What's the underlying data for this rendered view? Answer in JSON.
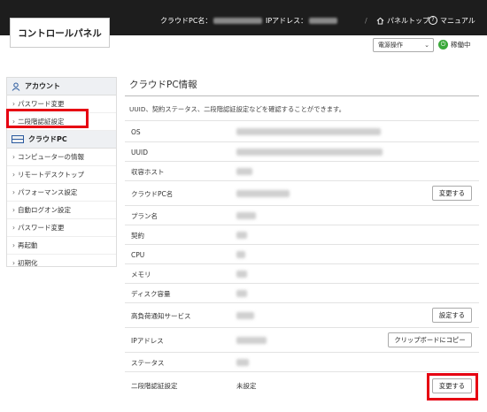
{
  "header": {
    "logo": "コントロールパネル",
    "pc_name_label": "クラウドPC名：",
    "ip_label": "IPアドレス：",
    "divider": "/",
    "top_link": "パネルトップ",
    "manual_link": "マニュアル"
  },
  "toolbar": {
    "power_select": "電源操作",
    "status": "稼働中"
  },
  "sidebar": {
    "account_heading": "アカウント",
    "account_items": [
      "パスワード変更",
      "二段階認証設定"
    ],
    "cloud_heading": "クラウドPC",
    "cloud_items": [
      "コンピューターの情報",
      "リモートデスクトップ",
      "パフォーマンス設定",
      "自動ログオン設定",
      "パスワード変更",
      "再起動",
      "初期化"
    ]
  },
  "main": {
    "title": "クラウドPC情報",
    "description": "UUID、契約ステータス、二段階認証設定などを確認することができます。",
    "rows": [
      {
        "label": "OS"
      },
      {
        "label": "UUID"
      },
      {
        "label": "収容ホスト"
      },
      {
        "label": "クラウドPC名",
        "button": "変更する"
      },
      {
        "label": "プラン名"
      },
      {
        "label": "契約"
      },
      {
        "label": "CPU"
      },
      {
        "label": "メモリ"
      },
      {
        "label": "ディスク容量"
      },
      {
        "label": "高負荷通知サービス",
        "button": "設定する"
      },
      {
        "label": "IPアドレス",
        "button": "クリップボードにコピー"
      },
      {
        "label": "ステータス"
      },
      {
        "label": "二段階認証設定",
        "value": "未設定",
        "button": "変更する"
      }
    ]
  },
  "colors": {
    "topbar": "#1d1d1d",
    "highlight": "#e60012",
    "status_green": "#3ba93b",
    "accent_blue": "#2b5a9e"
  }
}
